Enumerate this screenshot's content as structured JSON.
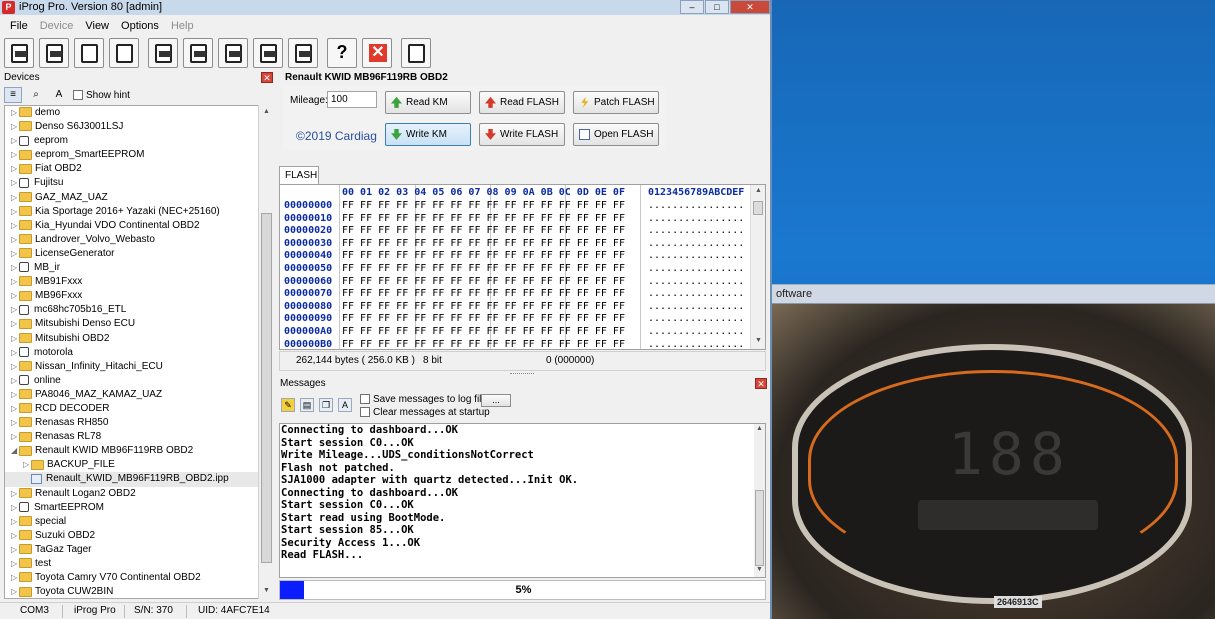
{
  "window": {
    "title": "iProg Pro. Version 80 [admin]"
  },
  "menu": [
    "File",
    "Device",
    "View",
    "Options",
    "Help"
  ],
  "devices": {
    "header": "Devices",
    "show_hint": "Show hint",
    "items": [
      {
        "label": "demo",
        "icon": "folder",
        "depth": 0,
        "expander": true
      },
      {
        "label": "Denso S6J3001LSJ",
        "icon": "folder",
        "depth": 0,
        "expander": true
      },
      {
        "label": "eeprom",
        "icon": "chip",
        "depth": 0,
        "expander": true
      },
      {
        "label": "eeprom_SmartEEPROM",
        "icon": "folder",
        "depth": 0,
        "expander": true
      },
      {
        "label": "Fiat OBD2",
        "icon": "folder",
        "depth": 0,
        "expander": true
      },
      {
        "label": "Fujitsu",
        "icon": "chip",
        "depth": 0,
        "expander": true
      },
      {
        "label": "GAZ_MAZ_UAZ",
        "icon": "folder",
        "depth": 0,
        "expander": true
      },
      {
        "label": "Kia Sportage 2016+ Yazaki (NEC+25160)",
        "icon": "folder",
        "depth": 0,
        "expander": true
      },
      {
        "label": "Kia_Hyundai VDO Continental OBD2",
        "icon": "folder",
        "depth": 0,
        "expander": true
      },
      {
        "label": "Landrover_Volvo_Webasto",
        "icon": "folder",
        "depth": 0,
        "expander": true
      },
      {
        "label": "LicenseGenerator",
        "icon": "folder",
        "depth": 0,
        "expander": true
      },
      {
        "label": "MB_ir",
        "icon": "chip",
        "depth": 0,
        "expander": true
      },
      {
        "label": "MB91Fxxx",
        "icon": "folder",
        "depth": 0,
        "expander": true
      },
      {
        "label": "MB96Fxxx",
        "icon": "folder",
        "depth": 0,
        "expander": true
      },
      {
        "label": "mc68hc705b16_ETL",
        "icon": "chip",
        "depth": 0,
        "expander": true
      },
      {
        "label": "Mitsubishi Denso ECU",
        "icon": "folder",
        "depth": 0,
        "expander": true
      },
      {
        "label": "Mitsubishi OBD2",
        "icon": "folder",
        "depth": 0,
        "expander": true
      },
      {
        "label": "motorola",
        "icon": "chip",
        "depth": 0,
        "expander": true
      },
      {
        "label": "Nissan_Infinity_Hitachi_ECU",
        "icon": "folder",
        "depth": 0,
        "expander": true
      },
      {
        "label": "online",
        "icon": "cloud",
        "depth": 0,
        "expander": true
      },
      {
        "label": "PA8046_MAZ_KAMAZ_UAZ",
        "icon": "folder",
        "depth": 0,
        "expander": true
      },
      {
        "label": "RCD DECODER",
        "icon": "folder",
        "depth": 0,
        "expander": true
      },
      {
        "label": "Renasas RH850",
        "icon": "folder",
        "depth": 0,
        "expander": true
      },
      {
        "label": "Renasas RL78",
        "icon": "folder",
        "depth": 0,
        "expander": true
      },
      {
        "label": "Renault KWID MB96F119RB OBD2",
        "icon": "folder",
        "depth": 0,
        "expander": true,
        "expanded": true
      },
      {
        "label": "BACKUP_FILE",
        "icon": "folder",
        "depth": 1,
        "expander": true
      },
      {
        "label": "Renault_KWID_MB96F119RB_OBD2.ipp",
        "icon": "file",
        "depth": 1,
        "expander": false,
        "selected": true
      },
      {
        "label": "Renault Logan2 OBD2",
        "icon": "folder",
        "depth": 0,
        "expander": true
      },
      {
        "label": "SmartEEPROM",
        "icon": "chip",
        "depth": 0,
        "expander": true
      },
      {
        "label": "special",
        "icon": "folder",
        "depth": 0,
        "expander": true
      },
      {
        "label": "Suzuki OBD2",
        "icon": "folder",
        "depth": 0,
        "expander": true
      },
      {
        "label": "TaGaz Tager",
        "icon": "folder",
        "depth": 0,
        "expander": true
      },
      {
        "label": "test",
        "icon": "folder",
        "depth": 0,
        "expander": true
      },
      {
        "label": "Toyota Camry V70 Continental OBD2",
        "icon": "folder",
        "depth": 0,
        "expander": true
      },
      {
        "label": "Toyota CUW2BIN",
        "icon": "folder",
        "depth": 0,
        "expander": true
      }
    ]
  },
  "device_panel": {
    "title": "Renault KWID MB96F119RB OBD2",
    "mileage_label": "Mileage:",
    "mileage_value": "100",
    "copyright": "©2019 Cardiag",
    "buttons": {
      "read_km": "Read KM",
      "read_flash": "Read FLASH",
      "patch_flash": "Patch FLASH",
      "write_km": "Write KM",
      "write_flash": "Write FLASH",
      "open_flash": "Open FLASH"
    }
  },
  "flash": {
    "tab": "FLASH",
    "header": "00 01 02 03 04 05 06 07 08 09 0A 0B 0C 0D 0E 0F",
    "ascii_header": "0123456789ABCDEF",
    "offsets": [
      "00000000",
      "00000010",
      "00000020",
      "00000030",
      "00000040",
      "00000050",
      "00000060",
      "00000070",
      "00000080",
      "00000090",
      "000000A0",
      "000000B0"
    ],
    "row_bytes": "FF FF FF FF FF FF FF FF FF FF FF FF FF FF FF FF",
    "row_ascii": "................",
    "size": "262,144 bytes ( 256.0 KB )",
    "bits": "8 bit",
    "position": "0 (000000)"
  },
  "messages": {
    "header": "Messages",
    "save_to_log": "Save messages to log file",
    "clear_at_startup": "Clear messages at startup",
    "browse": "...",
    "lines": [
      "Connecting to dashboard...OK",
      "Start session C0...OK",
      "Write Mileage...UDS_conditionsNotCorrect",
      "Flash not patched.",
      "SJA1000 adapter with quartz detected...Init OK.",
      "Connecting to dashboard...OK",
      "Start session C0...OK",
      "Start read using BootMode.",
      "Start session 85...OK",
      "Security Access 1...OK",
      "Read FLASH..."
    ]
  },
  "progress": {
    "value": 0.05,
    "label": "5%"
  },
  "statusbar": {
    "port": "COM3",
    "product": "iProg Pro",
    "serial": "S/N: 370",
    "uid": "UID: 4AFC7E14"
  },
  "desktop": {
    "strip_text": "oftware",
    "photo_label": "2646913C"
  },
  "colors": {
    "progress_fill": "#0a1eff",
    "hex_header": "#0a2aa6",
    "copyright": "#2b4f9c"
  }
}
